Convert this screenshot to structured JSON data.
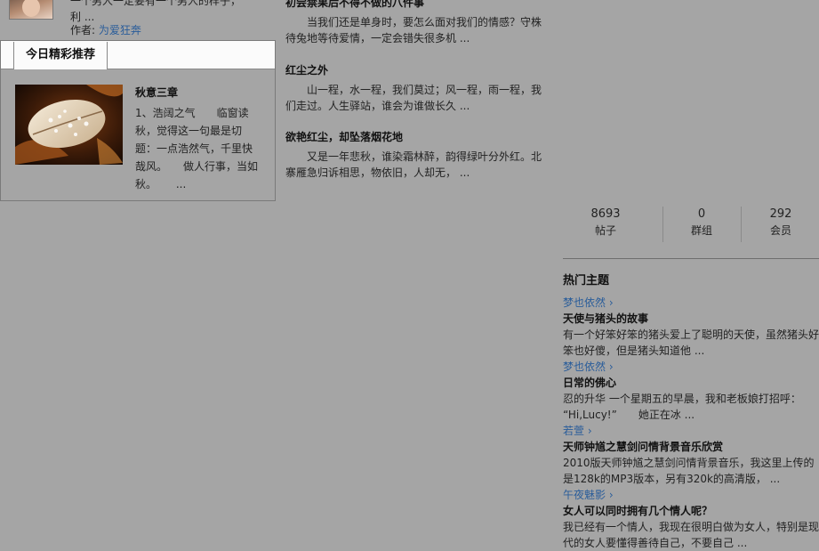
{
  "author": {
    "excerpt_line1": "一个男人一定要有一个男人的样子，",
    "excerpt_line2": "利 ...",
    "author_label": "作者:",
    "author_name": "为爱狂奔"
  },
  "featured": {
    "tab_label": "今日精彩推荐",
    "title": "秋意三章",
    "text": "1、浩阔之气　　临窗读秋，觉得这一句最是切题：一点浩然气，千里快哉风。　　做人行事，当如秋。　　 ..."
  },
  "articles": [
    {
      "title": "初尝禁果后不得不做的八件事",
      "summary": "当我们还是单身时，要怎么面对我们的情感？守株待兔地等待爱情，一定会错失很多机 ..."
    },
    {
      "title": "红尘之外",
      "summary": "山一程，水一程，我们莫过；风一程，雨一程，我们走过。人生驿站，谁会为谁做长久 ..."
    },
    {
      "title": "欲艳红尘，却坠落烟花地",
      "summary": "又是一年悲秋，谁染霜林醉，韵得绿叶分外红。北寨雁急归诉相思，物依旧，人却无， ..."
    }
  ],
  "stats": [
    {
      "value": "8693",
      "label": "帖子"
    },
    {
      "value": "0",
      "label": "群组"
    },
    {
      "value": "292",
      "label": "会员"
    }
  ],
  "hot": {
    "heading": "热门主题",
    "items": [
      {
        "author": "梦也依然 ›",
        "title": "天使与猪头的故事",
        "summary_line1": "有一个好笨好笨的猪头爱上了聪明的天使，虽然猪头好",
        "summary_line2": "笨也好傻，但是猪头知道他 ..."
      },
      {
        "author": "梦也依然 ›",
        "title": "日常的佛心",
        "summary_line1": "忍的升华 一个星期五的早晨，我和老板娘打招呼：",
        "summary_line2": "“Hi,Lucy!”　　她正在冰 ..."
      },
      {
        "author": "若萱 ›",
        "title": "天师钟馗之慧剑问情背景音乐欣赏",
        "summary_line1": "2010版天师钟馗之慧剑问情背景音乐，我这里上传的",
        "summary_line2": "是128k的MP3版本，另有320k的高清版， ..."
      },
      {
        "author": "午夜魅影 ›",
        "title": "女人可以同时拥有几个情人呢？",
        "summary_line1": "我已经有一个情人，我现在很明白做为女人，特别是现",
        "summary_line2": "代的女人要懂得善待自己，不要自己 ..."
      }
    ]
  }
}
